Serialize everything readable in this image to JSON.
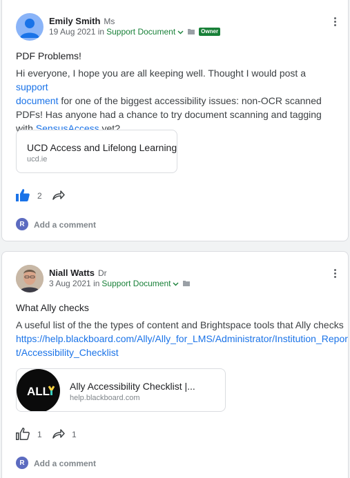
{
  "posts": [
    {
      "author": "Emily Smith",
      "author_title": "Ms",
      "date": "19 Aug 2021",
      "in_word": "in",
      "category": "Support Document",
      "badge": "Owner",
      "title": "PDF Problems!",
      "body": {
        "p1": "Hi everyone, I hope you are all keeping well. Thought I would post a ",
        "link1": "support",
        "link2": "document",
        "p2": " for one of the biggest accessibility issues: non-OCR scanned PDFs! Has anyone had a chance to try document scanning and tagging with ",
        "link3": "SensusAccess",
        "p3": " yet?"
      },
      "link_card": {
        "title": "UCD Access and Lifelong Learning",
        "url": "ucd.ie"
      },
      "like_count": "2",
      "share_count": "",
      "comment_avatar": "R",
      "add_comment": "Add a comment"
    },
    {
      "author": "Niall Watts",
      "author_title": "Dr",
      "date": "3 Aug 2021",
      "in_word": "in",
      "category": "Support Document",
      "title": "What Ally checks",
      "body": {
        "p1": "A useful list of the the types of content and Brightspace tools that Ally checks",
        "link1": "https://help.blackboard.com/Ally/Ally_for_LMS/Administrator/Institution_Repor",
        "link2": "t/Accessibility_Checklist"
      },
      "link_card": {
        "title": "Ally Accessibility Checklist |...",
        "url": "help.blackboard.com",
        "logo_text": "ALLY"
      },
      "like_count": "1",
      "share_count": "1",
      "comment_avatar": "R",
      "add_comment": "Add a comment"
    }
  ],
  "icons": {
    "avatar1": "person-avatar-icon",
    "chevron": "chevron-down-icon",
    "folder": "folder-icon",
    "kebab": "more-vert-icon",
    "like": "thumb-up-icon",
    "share": "share-arrow-icon"
  },
  "colors": {
    "link": "#1a73e8",
    "category": "#188038",
    "avatar_bg": "#8ab4f8",
    "comment_avatar_bg": "#5c6bc0",
    "like_active": "#1a73e8"
  }
}
